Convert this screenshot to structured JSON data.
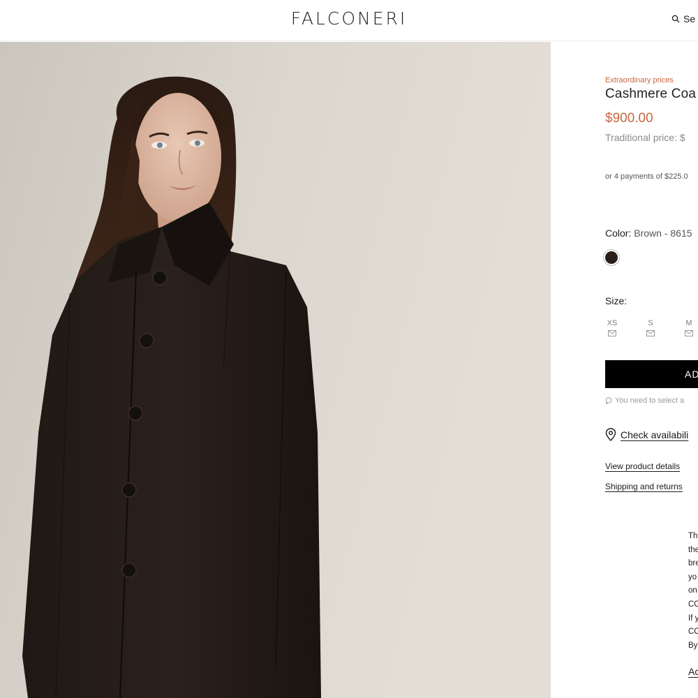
{
  "header": {
    "logo": "FALCONERI",
    "search_label": "Se"
  },
  "product": {
    "promo_label": "Extraordinary prices",
    "title": "Cashmere Coa",
    "price": "$900.00",
    "traditional_price": "Traditional price: $",
    "installments": "or 4 payments of $225.0",
    "color_label": "Color:",
    "color_value": "Brown - 8615",
    "swatch_color": "#2a1e1a",
    "size_label": "Size:",
    "sizes": [
      "XS",
      "S",
      "M"
    ],
    "add_button": "AD",
    "size_hint": "You need to select a",
    "check_availability": "Check availabili",
    "view_details": "View product details",
    "shipping_returns": "Shipping and returns"
  },
  "cookie_banner": {
    "lines": [
      "Th",
      "the",
      "bre",
      "yo",
      "on",
      "CO",
      "If y",
      "CO",
      "By"
    ],
    "link": "Ac"
  },
  "colors": {
    "accent": "#c8663f",
    "button": "#000000"
  }
}
